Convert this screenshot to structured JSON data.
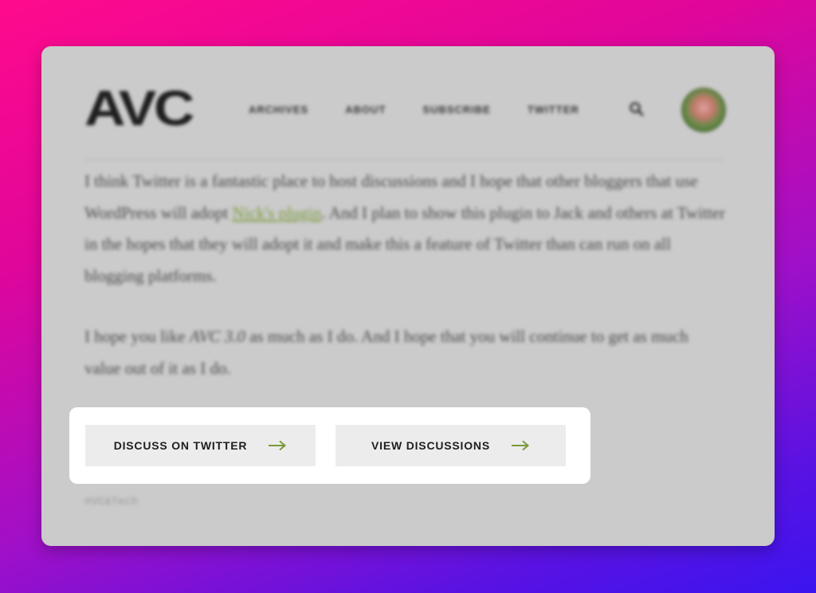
{
  "site": {
    "logo": "AVC",
    "nav": [
      "ARCHIVES",
      "ABOUT",
      "SUBSCRIBE",
      "TWITTER"
    ],
    "search_icon": "search-icon",
    "avatar_icon": "avatar"
  },
  "article": {
    "para1_before_link": "I think Twitter is a fantastic place to host discussions and I hope that other bloggers that use WordPress will adopt ",
    "para1_link": "Nick's plugin",
    "para1_after_link": ". And I plan to show this plugin to Jack and others at Twitter in the hopes that they will adopt it and make this a feature of Twitter than can run on all blogging platforms.",
    "para2_before_em": "I hope you like ",
    "para2_em": "AVC 3.0",
    "para2_after_em": " as much as I do. And I hope that you will continue to get as much value out of it as I do.",
    "hashtag": "#VC&Tech"
  },
  "actions": {
    "discuss_label": "DISCUSS ON TWITTER",
    "view_label": "VIEW DISCUSSIONS",
    "arrow_icon": "arrow-right-icon"
  },
  "colors": {
    "accent": "#7a9a3a",
    "card_bg": "#cbcbcb",
    "button_bg": "#ececec"
  }
}
